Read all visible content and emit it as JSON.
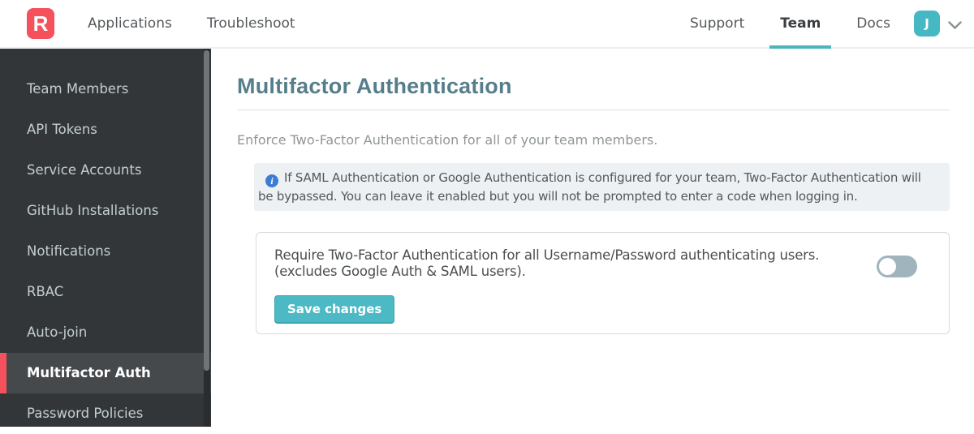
{
  "navbar": {
    "logo_letter": "R",
    "items_left": [
      {
        "label": "Applications"
      },
      {
        "label": "Troubleshoot"
      }
    ],
    "items_right": [
      {
        "label": "Support"
      },
      {
        "label": "Team"
      },
      {
        "label": "Docs"
      }
    ],
    "active_tab": "Team",
    "avatar_letter": "J"
  },
  "sidebar": {
    "items": [
      {
        "label": "Team Members"
      },
      {
        "label": "API Tokens"
      },
      {
        "label": "Service Accounts"
      },
      {
        "label": "GitHub Installations"
      },
      {
        "label": "Notifications"
      },
      {
        "label": "RBAC"
      },
      {
        "label": "Auto-join"
      },
      {
        "label": "Multifactor Auth"
      },
      {
        "label": "Password Policies"
      }
    ],
    "active_item": "Multifactor Auth"
  },
  "main": {
    "title": "Multifactor Authentication",
    "intro": "Enforce Two-Factor Authentication for all of your team members.",
    "info_icon_glyph": "i",
    "info_note": "If SAML Authentication or Google Authentication is configured for your team, Two-Factor Authentication will be bypassed. You can leave it enabled but you will not be prompted to enter a code when logging in.",
    "card": {
      "label_line1": "Require Two-Factor Authentication for all Username/Password authenticating users.",
      "label_line2": "(excludes Google Auth & SAML users).",
      "toggle_state": "off",
      "save_label": "Save changes"
    }
  },
  "colors": {
    "brand_red": "#f4515c",
    "accent_teal": "#4cb9c4",
    "avatar_teal": "#45b8c4",
    "heading_slate": "#567e8a",
    "sidebar_bg": "#323639",
    "sidebar_active_bg": "#46494c",
    "info_icon_blue": "#3b7cd5",
    "toggle_off_track": "#9fb4bd"
  }
}
